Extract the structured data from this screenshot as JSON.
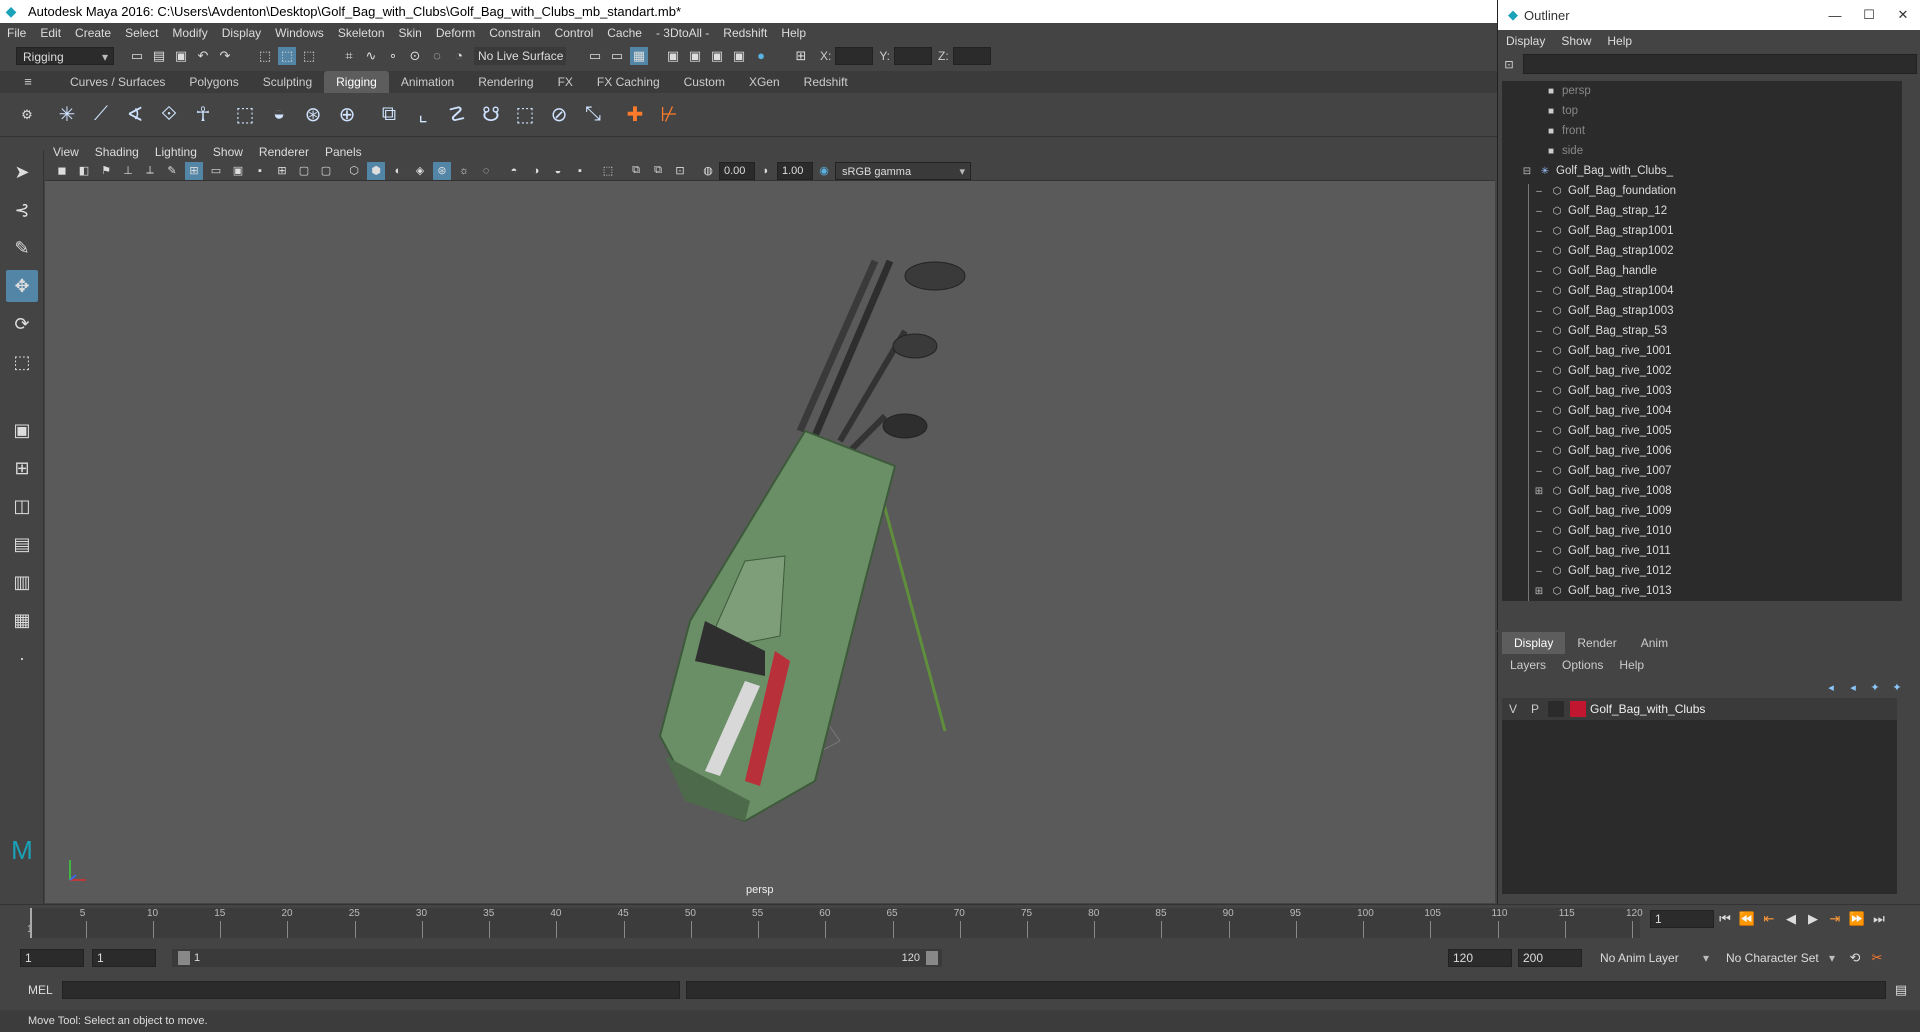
{
  "window": {
    "title": "Autodesk Maya 2016: C:\\Users\\Avdenton\\Desktop\\Golf_Bag_with_Clubs\\Golf_Bag_with_Clubs_mb_standart.mb*"
  },
  "menubar": [
    "File",
    "Edit",
    "Create",
    "Select",
    "Modify",
    "Display",
    "Windows",
    "Skeleton",
    "Skin",
    "Deform",
    "Constrain",
    "Control",
    "Cache",
    "- 3DtoAll -",
    "Redshift",
    "Help"
  ],
  "statusline": {
    "mode": "Rigging",
    "live_surface": "No Live Surface",
    "x_label": "X:",
    "y_label": "Y:",
    "z_label": "Z:"
  },
  "shelf_tabs": [
    "Curves / Surfaces",
    "Polygons",
    "Sculpting",
    "Rigging",
    "Animation",
    "Rendering",
    "FX",
    "FX Caching",
    "Custom",
    "XGen",
    "Redshift"
  ],
  "active_shelf": "Rigging",
  "panel_menu": [
    "View",
    "Shading",
    "Lighting",
    "Show",
    "Renderer",
    "Panels"
  ],
  "panel_tools": {
    "exposure": "0.00",
    "gamma": "1.00",
    "colorspace": "sRGB gamma"
  },
  "viewport": {
    "camera": "persp"
  },
  "outliner": {
    "title": "Outliner",
    "menu": [
      "Display",
      "Show",
      "Help"
    ],
    "cameras": [
      "persp",
      "top",
      "front",
      "side"
    ],
    "root": "Golf_Bag_with_Clubs_",
    "children": [
      "Golf_Bag_foundation",
      "Golf_Bag_strap_12",
      "Golf_Bag_strap1001",
      "Golf_Bag_strap1002",
      "Golf_Bag_handle",
      "Golf_Bag_strap1004",
      "Golf_Bag_strap1003",
      "Golf_Bag_strap_53",
      "Golf_bag_rive_1001",
      "Golf_bag_rive_1002",
      "Golf_bag_rive_1003",
      "Golf_bag_rive_1004",
      "Golf_bag_rive_1005",
      "Golf_bag_rive_1006",
      "Golf_bag_rive_1007",
      "Golf_bag_rive_1008",
      "Golf_bag_rive_1009",
      "Golf_bag_rive_1010",
      "Golf_bag_rive_1011",
      "Golf_bag_rive_1012",
      "Golf_bag_rive_1013"
    ],
    "expandable": [
      "Golf_bag_rive_1008",
      "Golf_bag_rive_1013"
    ]
  },
  "layers": {
    "tabs": [
      "Display",
      "Render",
      "Anim"
    ],
    "active_tab": "Display",
    "menu": [
      "Layers",
      "Options",
      "Help"
    ],
    "items": [
      {
        "v": "V",
        "p": "P",
        "name": "Golf_Bag_with_Clubs",
        "color": "#c0162f"
      }
    ]
  },
  "timeline": {
    "ticks": [
      5,
      10,
      15,
      20,
      25,
      30,
      35,
      40,
      45,
      50,
      55,
      60,
      65,
      70,
      75,
      80,
      85,
      90,
      95,
      100,
      105,
      110,
      115,
      120
    ],
    "start_label": "1",
    "current_frame": "1",
    "range_start": "1",
    "range_inner_start": "1",
    "slider_start": "1",
    "slider_end": "120",
    "range_end": "120",
    "anim_end": "200",
    "anim_layer": "No Anim Layer",
    "character_set": "No Character Set"
  },
  "command": {
    "label": "MEL"
  },
  "help_line": "Move Tool: Select an object to move."
}
